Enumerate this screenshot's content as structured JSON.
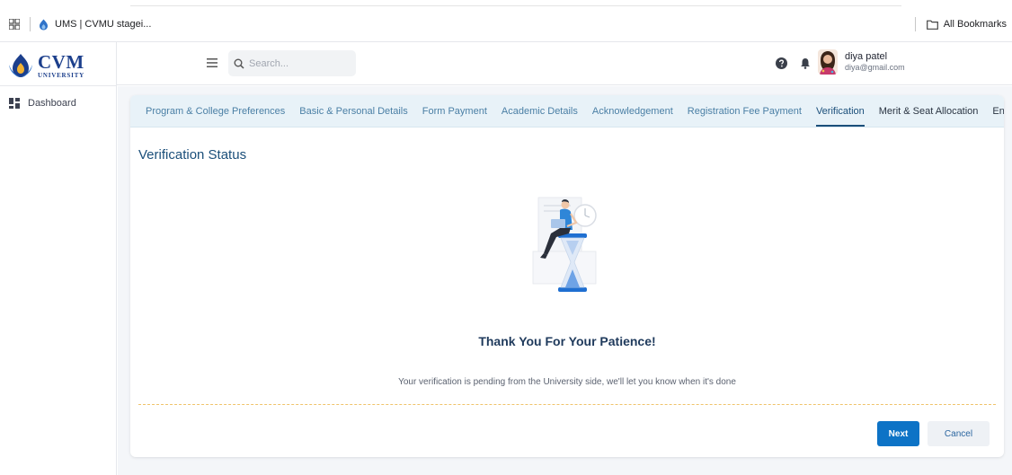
{
  "browser": {
    "tab_title": "UMS | CVMU stagei...",
    "bookmarks_label": "All Bookmarks"
  },
  "sidebar": {
    "logo": {
      "big": "CVM",
      "small": "UNIVERSITY"
    },
    "items": [
      {
        "label": "Dashboard",
        "icon": "dashboard-icon"
      }
    ]
  },
  "header": {
    "search_placeholder": "Search...",
    "user": {
      "name": "diya patel",
      "email": "diya@gmail.com"
    }
  },
  "tabs": [
    {
      "label": "Program & College Preferences",
      "active": false
    },
    {
      "label": "Basic & Personal Details",
      "active": false
    },
    {
      "label": "Form Payment",
      "active": false
    },
    {
      "label": "Academic Details",
      "active": false
    },
    {
      "label": "Acknowledgement",
      "active": false
    },
    {
      "label": "Registration Fee Payment",
      "active": false
    },
    {
      "label": "Verification",
      "active": true
    },
    {
      "label": "Merit & Seat Allocation",
      "active": false
    },
    {
      "label": "Enrollment",
      "active": false
    }
  ],
  "content": {
    "title": "Verification Status",
    "heading": "Thank You For Your Patience!",
    "message": "Your verification is pending from the University side, we'll let you know when it's done"
  },
  "actions": {
    "next": "Next",
    "cancel": "Cancel"
  },
  "colors": {
    "primary": "#0d73c6",
    "brand": "#1c3f8c",
    "tab_bar": "#e8f2f8",
    "title": "#1b4f7a"
  }
}
